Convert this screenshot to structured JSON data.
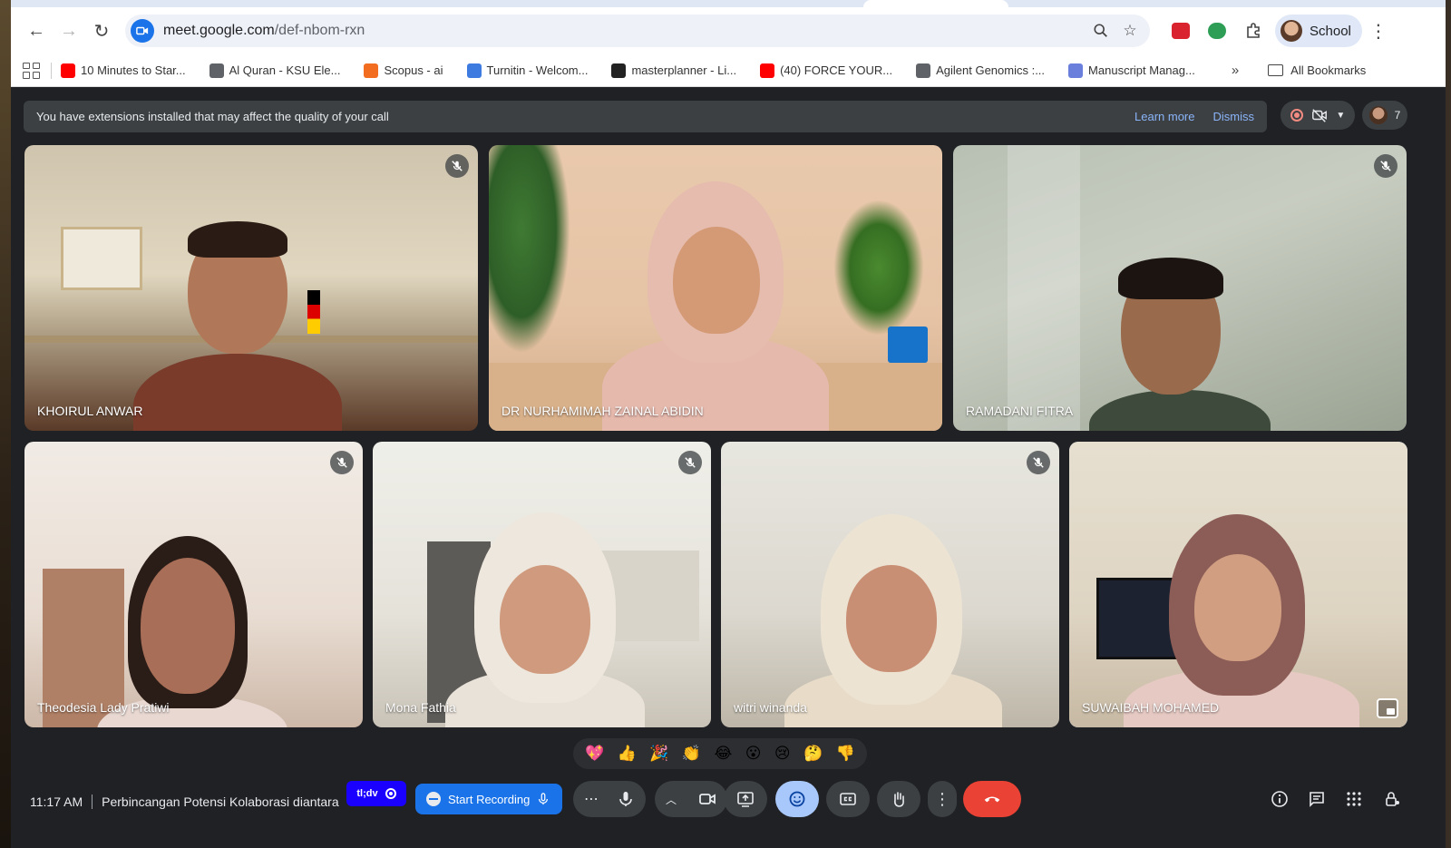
{
  "browser": {
    "url_host": "meet.google.com",
    "url_path": "/def-nbom-rxn",
    "profile_label": "School",
    "bookmarks": [
      {
        "label": "10 Minutes to Star...",
        "icon": "youtube-icon",
        "color": "#ff0000"
      },
      {
        "label": "Al Quran - KSU Ele...",
        "icon": "globe-icon",
        "color": "#5f6368"
      },
      {
        "label": "Scopus - ai",
        "icon": "scopus-icon",
        "color": "#f36d21"
      },
      {
        "label": "Turnitin - Welcom...",
        "icon": "turnitin-icon",
        "color": "#3d7be0"
      },
      {
        "label": "masterplanner - Li...",
        "icon": "masterplanner-icon",
        "color": "#222222"
      },
      {
        "label": "(40) FORCE YOUR...",
        "icon": "youtube-icon",
        "color": "#ff0000"
      },
      {
        "label": "Agilent Genomics :...",
        "icon": "globe-icon",
        "color": "#5f6368"
      },
      {
        "label": "Manuscript Manag...",
        "icon": "manuscript-icon",
        "color": "#6a7fdb"
      }
    ],
    "all_bookmarks_label": "All Bookmarks"
  },
  "meet": {
    "banner": {
      "text": "You have extensions installed that may affect the quality of your call",
      "learn_more": "Learn more",
      "dismiss": "Dismiss"
    },
    "participant_count": "7",
    "participants": [
      {
        "name": "KHOIRUL ANWAR",
        "muted": true
      },
      {
        "name": "DR NURHAMIMAH ZAINAL ABIDIN",
        "muted": false
      },
      {
        "name": "RAMADANI FITRA",
        "muted": true
      },
      {
        "name": "Theodesia Lady Pratiwi",
        "muted": true
      },
      {
        "name": "Mona Fathia",
        "muted": true
      },
      {
        "name": "witri winanda",
        "muted": true
      },
      {
        "name": "SUWAIBAH MOHAMED",
        "muted": false,
        "speaking": true
      }
    ],
    "reactions": [
      "💖",
      "👍",
      "🎉",
      "👏",
      "😂",
      "😮",
      "😢",
      "🤔",
      "👎"
    ],
    "time": "11:17 AM",
    "meeting_title": "Perbincangan Potensi Kolaborasi diantara",
    "tldv_label": "tl;dv",
    "start_recording": "Start Recording"
  },
  "colors": {
    "meet_bg": "#202124",
    "accent_blue": "#1a73e8",
    "active_control": "#a8c7fa",
    "hangup": "#ea4335"
  }
}
